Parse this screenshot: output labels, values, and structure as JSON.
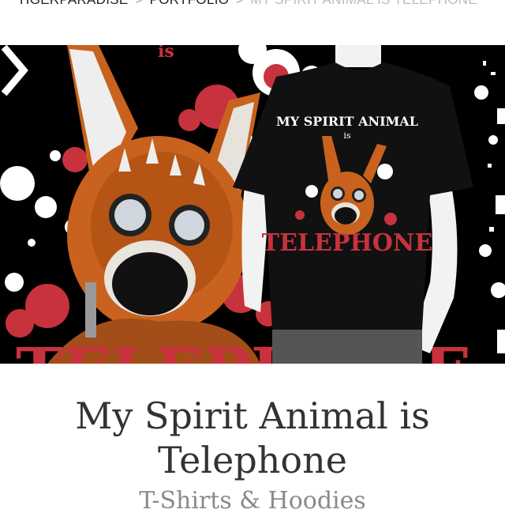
{
  "breadcrumb": {
    "items": [
      {
        "label": "TIGERPARADISE"
      },
      {
        "label": "PORTFOLIO"
      },
      {
        "label": "MY SPIRIT ANIMAL IS TELEPHONE"
      }
    ],
    "separator": ">"
  },
  "product": {
    "title_line1": "My Spirit Animal is",
    "title_line2": "Telephone",
    "category": "T-Shirts & Hoodies"
  },
  "artwork": {
    "shirt_line1": "MY SPIRIT ANIMAL",
    "shirt_line2": "is",
    "shirt_line3": "TELEPHONE",
    "banner_text": "TELEPHONE",
    "top_text": "is"
  },
  "colors": {
    "accent_red": "#c8323c",
    "fur_orange": "#c8621e",
    "title_gray": "#333333",
    "subtitle_gray": "#8a8a8a"
  },
  "icons": {
    "next": "chevron-right-icon"
  }
}
